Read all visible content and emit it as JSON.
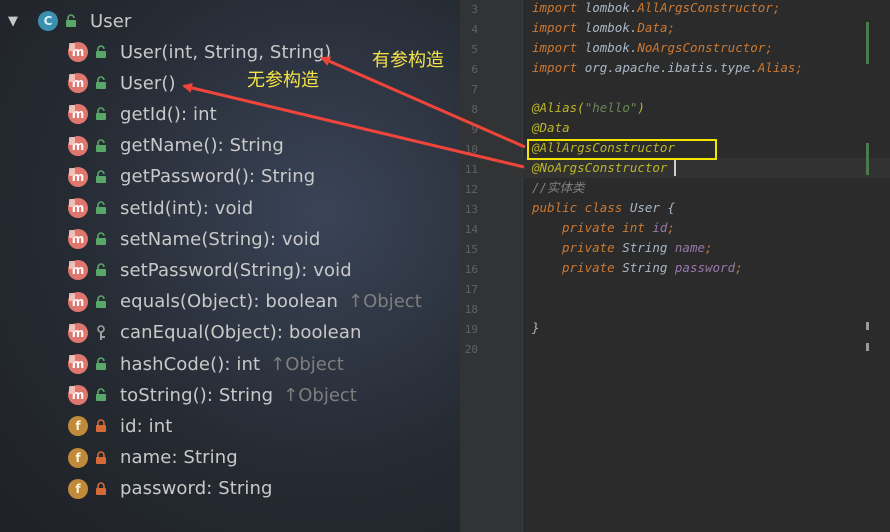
{
  "structure": {
    "root": {
      "badge": "C",
      "label": "User"
    },
    "members": [
      {
        "badge": "m",
        "vis": "public",
        "label": "User(int, String, String)",
        "inherit": ""
      },
      {
        "badge": "m",
        "vis": "public",
        "label": "User()",
        "inherit": ""
      },
      {
        "badge": "m",
        "vis": "public",
        "label": "getId(): int",
        "inherit": ""
      },
      {
        "badge": "m",
        "vis": "public",
        "label": "getName(): String",
        "inherit": ""
      },
      {
        "badge": "m",
        "vis": "public",
        "label": "getPassword(): String",
        "inherit": ""
      },
      {
        "badge": "m",
        "vis": "public",
        "label": "setId(int): void",
        "inherit": ""
      },
      {
        "badge": "m",
        "vis": "public",
        "label": "setName(String): void",
        "inherit": ""
      },
      {
        "badge": "m",
        "vis": "public",
        "label": "setPassword(String): void",
        "inherit": ""
      },
      {
        "badge": "m",
        "vis": "public",
        "label": "equals(Object): boolean",
        "inherit": "↑Object"
      },
      {
        "badge": "m",
        "vis": "protected",
        "label": "canEqual(Object): boolean",
        "inherit": ""
      },
      {
        "badge": "m",
        "vis": "public",
        "label": "hashCode(): int",
        "inherit": "↑Object"
      },
      {
        "badge": "m",
        "vis": "public",
        "label": "toString(): String",
        "inherit": "↑Object"
      },
      {
        "badge": "f",
        "vis": "private",
        "label": "id: int",
        "inherit": ""
      },
      {
        "badge": "f",
        "vis": "private",
        "label": "name: String",
        "inherit": ""
      },
      {
        "badge": "f",
        "vis": "private",
        "label": "password: String",
        "inherit": ""
      }
    ]
  },
  "annotations": {
    "with_args": "有参构造",
    "no_args": "无参构造"
  },
  "editor": {
    "line_numbers": [
      "3",
      "4",
      "5",
      "6",
      "7",
      "8",
      "9",
      "10",
      "11",
      "12",
      "13",
      "14",
      "15",
      "16",
      "17",
      "18",
      "19",
      "20"
    ],
    "code": [
      {
        "kw": "import ",
        "rest": "lombok.",
        "cls": "AllArgsConstructor",
        "end": ";"
      },
      {
        "kw": "import ",
        "rest": "lombok.",
        "cls": "Data",
        "end": ";"
      },
      {
        "kw": "import ",
        "rest": "lombok.",
        "cls": "NoArgsConstructor",
        "end": ";"
      },
      {
        "kw": "import ",
        "rest": "org.apache.ibatis.type.",
        "cls": "Alias",
        "end": ";"
      }
    ],
    "alias_anno": "@Alias(",
    "alias_value": "\"hello\"",
    "alias_close": ")",
    "data_anno": "@Data",
    "all_args_anno": "@AllArgsConstructor",
    "no_args_anno": "@NoArgsConstructor",
    "comment": "//实体类",
    "class_decl_kw": "public class ",
    "class_name": "User {",
    "fields": [
      {
        "kw": "private ",
        "type_kw": "int ",
        "type": "",
        "name": "id",
        "end": ";"
      },
      {
        "kw": "private ",
        "type_kw": "",
        "type": "String ",
        "name": "name",
        "end": ";"
      },
      {
        "kw": "private ",
        "type_kw": "",
        "type": "String ",
        "name": "password",
        "end": ";"
      }
    ],
    "close_brace": "}"
  },
  "colors": {
    "annotation_arrow": "#f0453a",
    "highlight_box": "#f2e600",
    "note_text": "#f4e44a"
  }
}
